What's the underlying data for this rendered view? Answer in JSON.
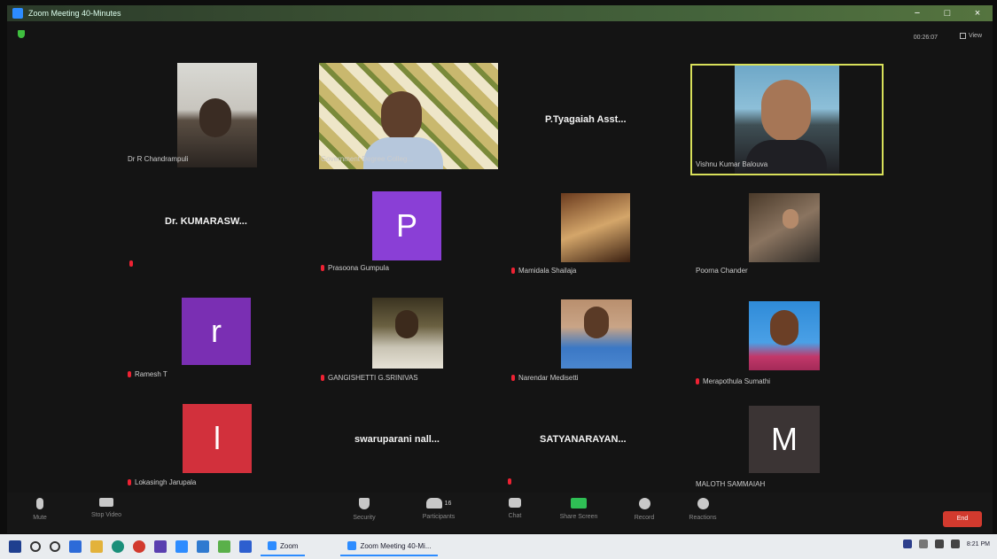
{
  "window": {
    "title": "Zoom Meeting 40-Minutes",
    "minimize": "−",
    "maximize": "□",
    "close": "×"
  },
  "top": {
    "timer": "00:26:07",
    "view_label": "View"
  },
  "participants": [
    {
      "name": "Dr R Chandrampuli",
      "kind": "video"
    },
    {
      "name": "Government Degree Colleg...",
      "kind": "video"
    },
    {
      "name": "P.Tyagaiah Asst...",
      "kind": "text"
    },
    {
      "name": "Vishnu Kumar Balouva",
      "kind": "video",
      "active_speaker": true
    },
    {
      "name": "Dr. KUMARASW...",
      "kind": "text"
    },
    {
      "name": "Prasoona Gumpula",
      "kind": "avatar",
      "initial": "P",
      "color": "#8a3fd6"
    },
    {
      "name": "Mamidala Shailaja",
      "kind": "video"
    },
    {
      "name": "Poorna Chander",
      "kind": "video"
    },
    {
      "name": "Ramesh T",
      "kind": "avatar",
      "initial": "r",
      "color": "#7a2fb3"
    },
    {
      "name": "GANGISHETTI G.SRINIVAS",
      "kind": "video"
    },
    {
      "name": "Narendar Medisetti",
      "kind": "video"
    },
    {
      "name": "Merapothula Sumathi",
      "kind": "video"
    },
    {
      "name": "Lokasingh Jarupala",
      "kind": "avatar",
      "initial": "l",
      "color": "#d2303c"
    },
    {
      "name": "swaruparani nall...",
      "kind": "text"
    },
    {
      "name": "SATYANARAYAN...",
      "kind": "text"
    },
    {
      "name": "MALOTH SAMMAIAH",
      "kind": "avatar",
      "initial": "M",
      "color": "#3b3434"
    }
  ],
  "toolbar": {
    "mute": "Mute",
    "stop_video": "Stop Video",
    "security": "Security",
    "participants": "Participants",
    "participants_count": "16",
    "chat": "Chat",
    "share_screen": "Share Screen",
    "record": "Record",
    "reactions": "Reactions",
    "end": "End"
  },
  "taskbar": {
    "task1": "Zoom",
    "task2": "Zoom Meeting 40-Mi...",
    "clock": "8:21 PM"
  },
  "colors": {
    "active_speaker_border": "#d8e05a",
    "end_button": "#d23a2e",
    "accent": "#2d8cff"
  }
}
